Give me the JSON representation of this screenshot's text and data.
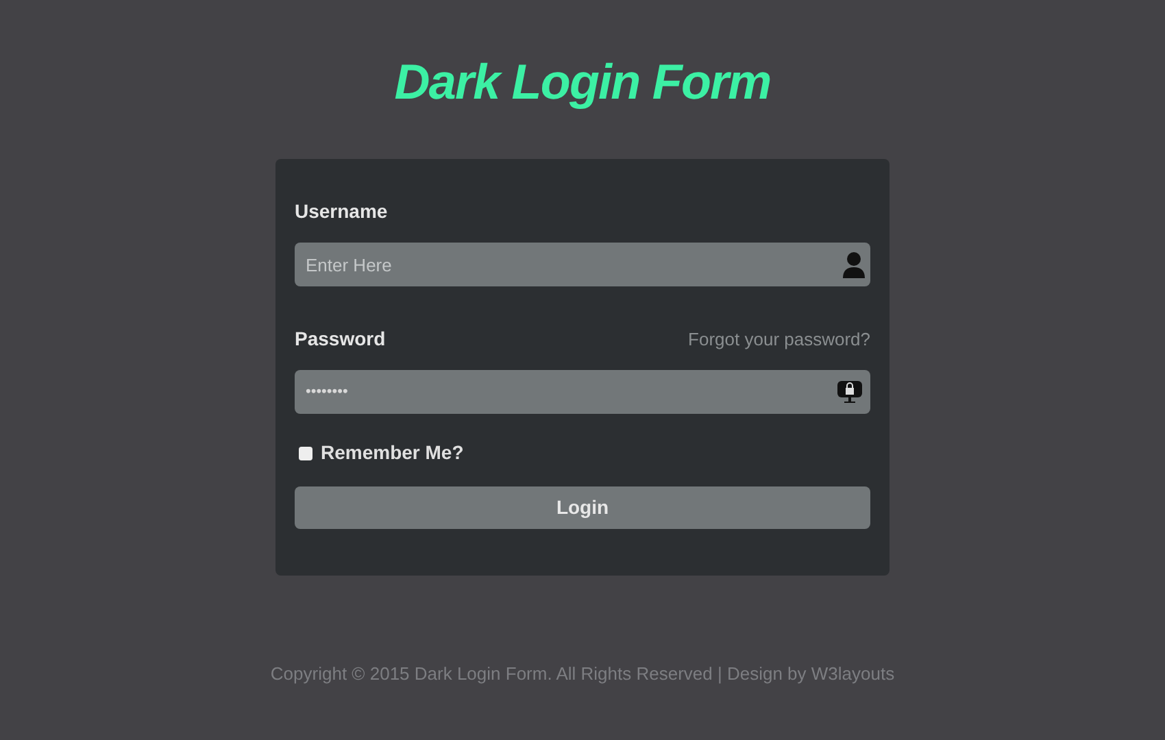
{
  "title": "Dark Login Form",
  "username": {
    "label": "Username",
    "placeholder": "Enter Here"
  },
  "password": {
    "label": "Password",
    "forgot_link": "Forgot your password?",
    "value": "••••••••"
  },
  "remember": {
    "label": "Remember Me?",
    "checked": false
  },
  "login_button": "Login",
  "footer": "Copyright © 2015 Dark Login Form. All Rights Reserved | Design by W3layouts"
}
